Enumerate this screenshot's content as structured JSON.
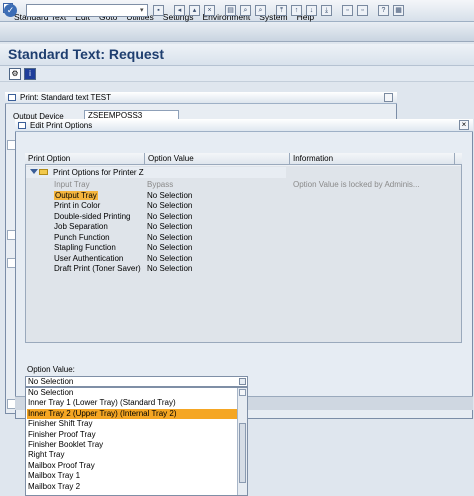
{
  "menubar": {
    "items": [
      "Standard Text",
      "Edit",
      "Goto",
      "Utilities",
      "Settings",
      "Environment",
      "System",
      "Help"
    ]
  },
  "toolbar": {
    "command_field": ""
  },
  "page": {
    "title": "Standard Text: Request"
  },
  "print_dialog": {
    "title": "Print: Standard text TEST",
    "output_device_label": "Output Device",
    "output_device_value": "ZSEEMPOSS3"
  },
  "edit_dialog": {
    "title": "Edit Print Options",
    "close_glyph": "×",
    "columns": [
      "Print Option",
      "Option Value",
      "Information"
    ],
    "group_label": "Print Options for Printer Z",
    "rows": [
      {
        "option": "Input Tray",
        "value": "Bypass",
        "info": "Option Value is locked by Adminis...",
        "disabled": true
      },
      {
        "option": "Output Tray",
        "value": "No Selection",
        "info": "",
        "highlight": true
      },
      {
        "option": "Print in Color",
        "value": "No Selection",
        "info": ""
      },
      {
        "option": "Double-sided Printing",
        "value": "No Selection",
        "info": ""
      },
      {
        "option": "Job Separation",
        "value": "No Selection",
        "info": ""
      },
      {
        "option": "Punch Function",
        "value": "No Selection",
        "info": ""
      },
      {
        "option": "Stapling Function",
        "value": "No Selection",
        "info": ""
      },
      {
        "option": "User Authentication",
        "value": "No Selection",
        "info": ""
      },
      {
        "option": "Draft Print (Toner Saver)",
        "value": "No Selection",
        "info": ""
      }
    ],
    "option_value_label": "Option Value:",
    "option_value_selected": "No Selection",
    "listbox_items": [
      "No Selection",
      "Inner Tray 1 (Lower Tray) (Standard Tray)",
      "Inner Tray 2 (Upper Tray) (Internal Tray 2)",
      "Finisher Shift Tray",
      "Finisher Proof Tray",
      "Finisher Booklet Tray",
      "Right Tray",
      "Mailbox Proof Tray",
      "Mailbox Tray 1",
      "Mailbox Tray 2"
    ],
    "listbox_selected_index": 2
  },
  "colors": {
    "highlight": "#f5a623",
    "title_text": "#1e3e6f"
  }
}
